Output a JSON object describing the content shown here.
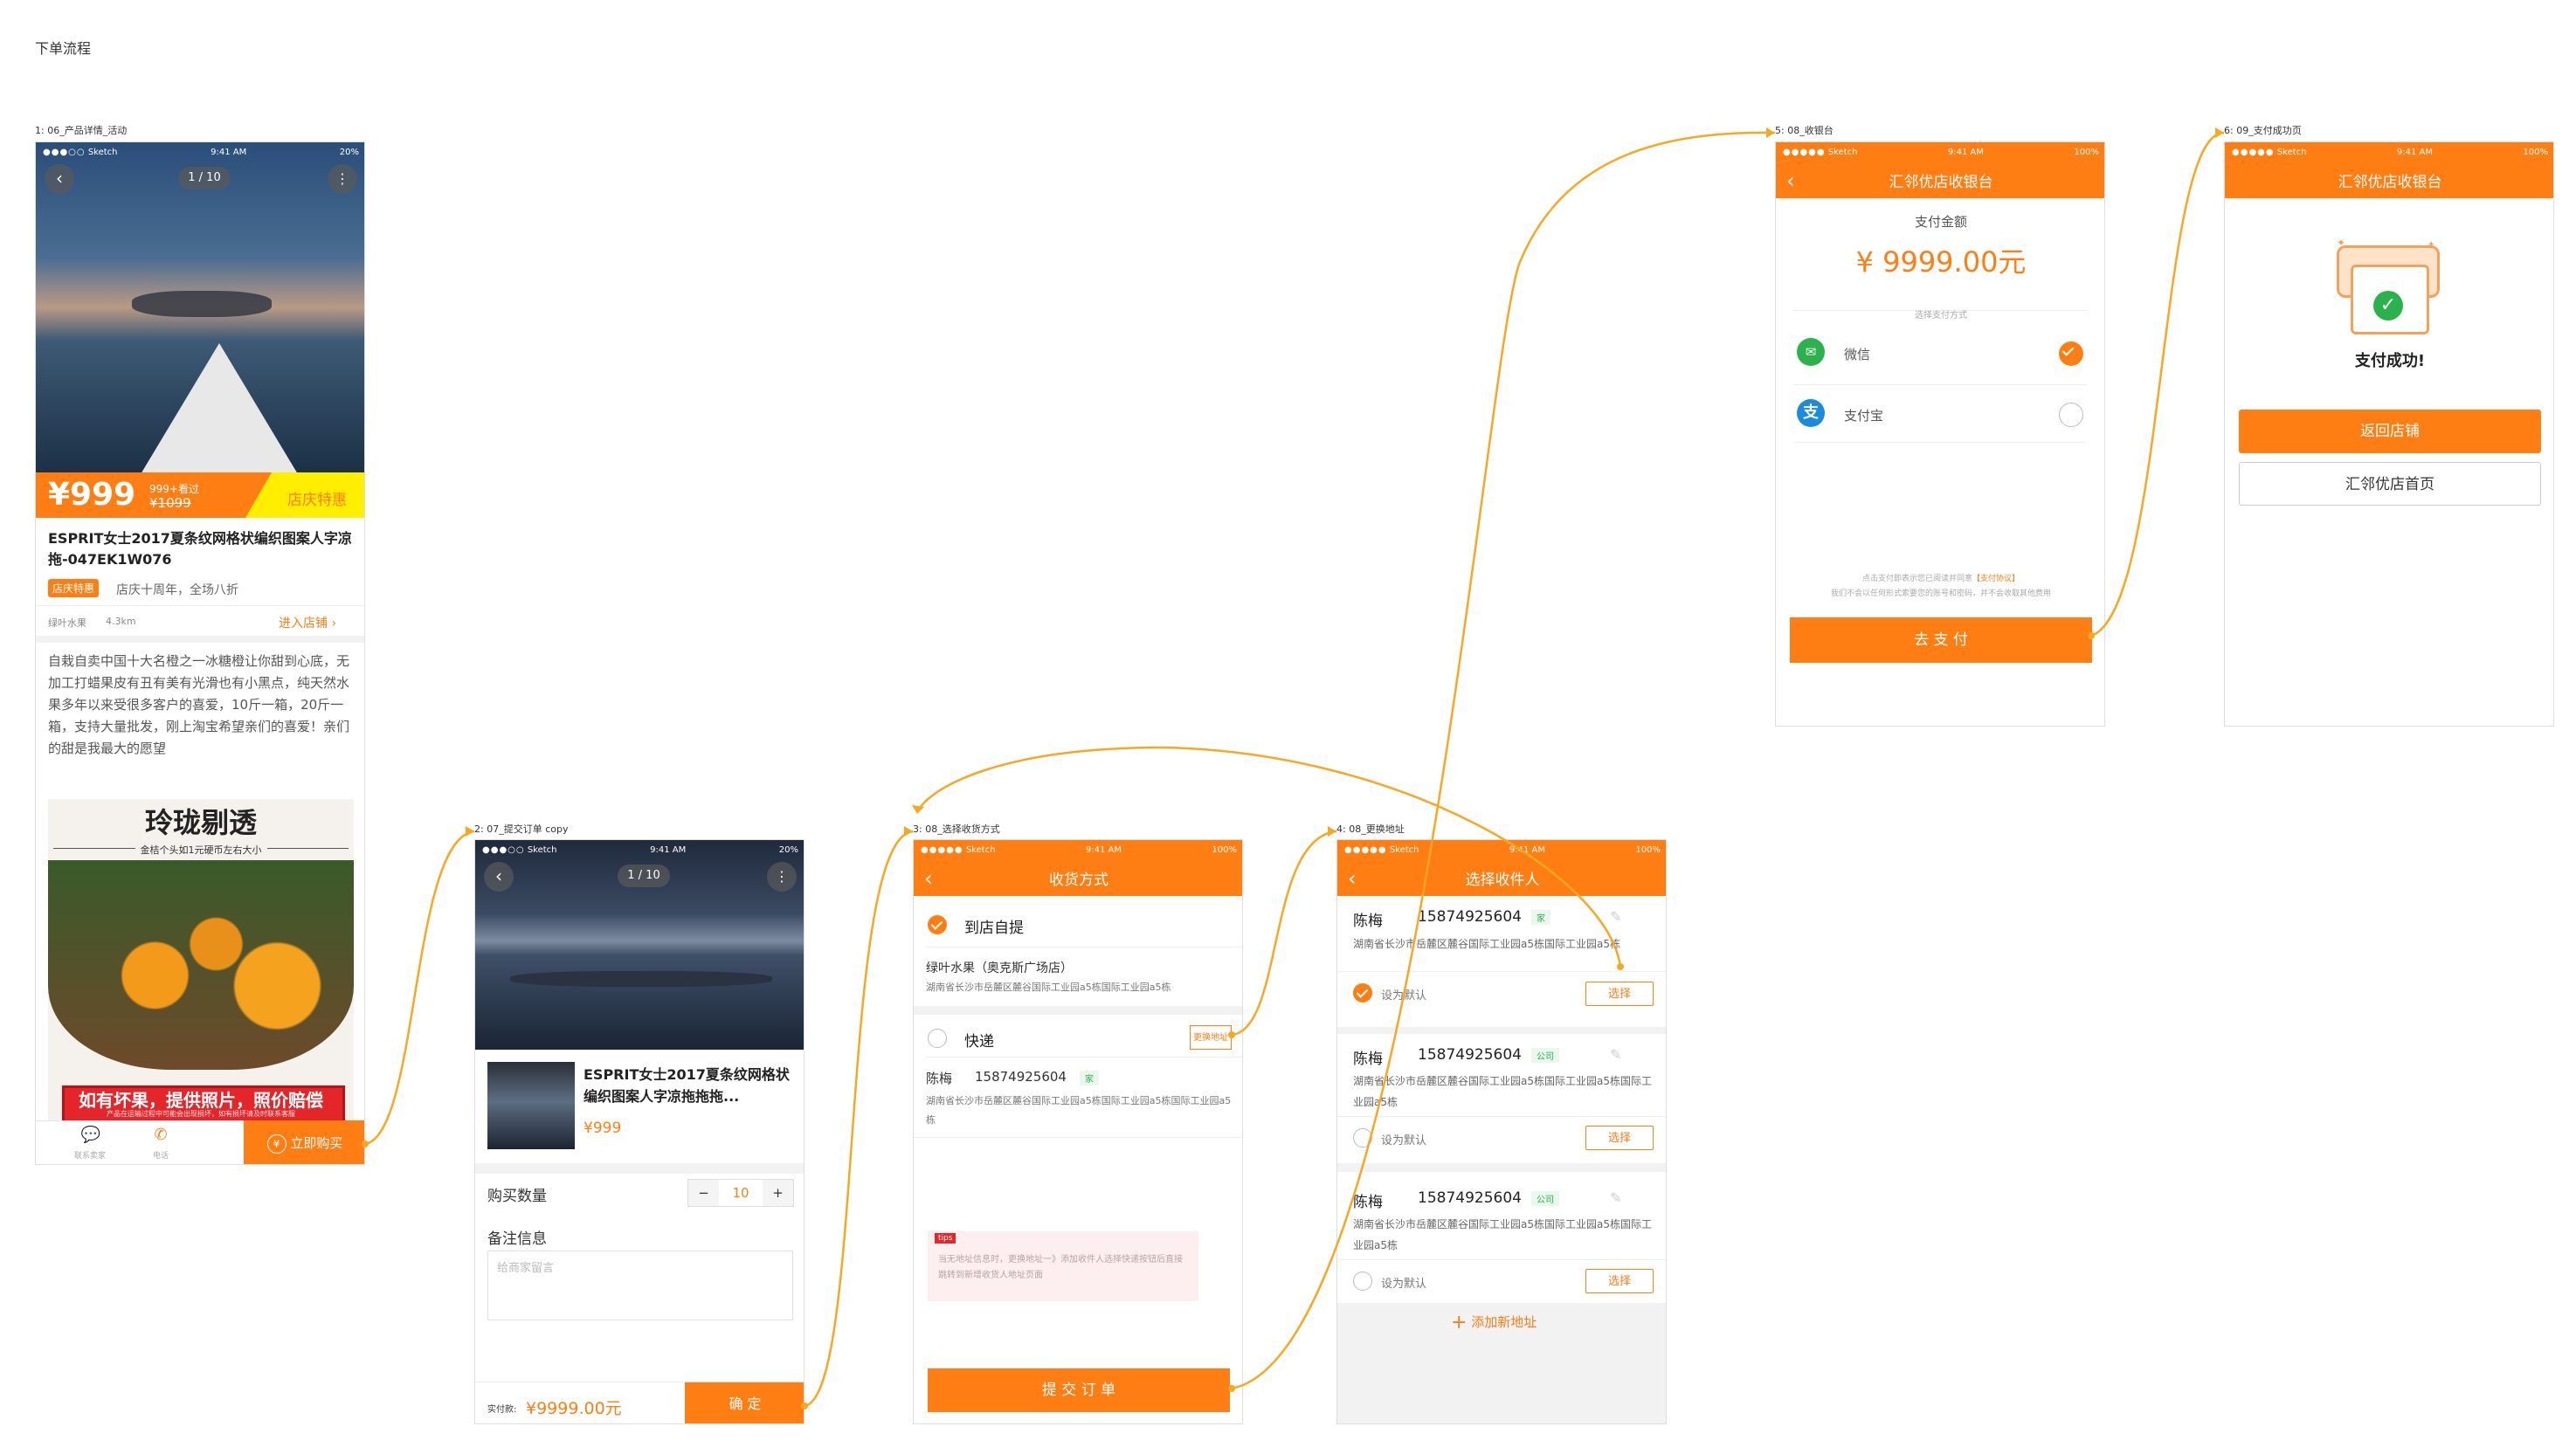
{
  "page_title": "下单流程",
  "colors": {
    "accent": "#ff7e14",
    "badge": "#ff7e14",
    "promo_yellow": "#ffee00",
    "success": "#2bb24c"
  },
  "connectors": 5,
  "status": {
    "carrier": "Sketch",
    "time": "9:41 AM",
    "battery_low": "20%",
    "battery_full": "100%"
  },
  "s1": {
    "label": "1: 06_产品详情_活动",
    "counter": "1 / 10",
    "price": "¥999",
    "sold": "999+看过",
    "old_price": "¥1099",
    "promo_tag": "店庆特惠",
    "title": "ESPRIT女士2017夏条纹网格状编织图案人字凉拖-047EK1W076",
    "badge": "店庆特惠",
    "promo_text": "店庆十周年，全场八折",
    "store": "绿叶水果",
    "distance": "4.3km",
    "enter_store": "进入店铺",
    "description": "自栽自卖中国十大名橙之一冰糖橙让你甜到心底，无加工打蜡果皮有丑有美有光滑也有小黑点，纯天然水果多年以来受很多客户的喜爱，10斤一箱，20斤一箱，支持大量批发，刚上淘宝希望亲们的喜爱！亲们的甜是我最大的愿望",
    "banner_title": "玲珑剔透",
    "banner_sub": "金桔个头如1元硬币左右大小",
    "guarantee": "如有坏果，提供照片，照价赔偿",
    "guarantee_small": "产品在运输过程中可能会出现损坏，如有损坏请及时联系客服",
    "tab1": "联系卖家",
    "tab2": "电话",
    "buy_now": "立即购买"
  },
  "s2": {
    "label": "2: 07_提交订单 copy",
    "counter": "1 / 10",
    "title": "ESPRIT女士2017夏条纹网格状编织图案人字凉拖拖拖...",
    "price": "¥999",
    "qty_label": "购买数量",
    "qty": "10",
    "minus": "−",
    "plus": "+",
    "remark_label": "备注信息",
    "remark_placeholder": "给商家留言",
    "pay_label": "实付款:",
    "pay_amount": "¥9999.00元",
    "confirm": "确 定"
  },
  "s3": {
    "label": "3: 08_选择收货方式",
    "nav_title": "收货方式",
    "opt1": "到店自提",
    "store_name": "绿叶水果（奥克斯广场店）",
    "store_addr": "湖南省长沙市岳麓区麓谷国际工业园a5栋国际工业园a5栋",
    "opt2": "快递",
    "change_addr": "更换地址",
    "name": "陈梅",
    "phone": "15874925604",
    "tag": "家",
    "addr": "湖南省长沙市岳麓区麓谷国际工业园a5栋国际工业园a5栋国际工业园a5栋",
    "tips_tag": "tips",
    "tips_text": "当无地址信息时，更换地址一》添加收件人选择快递按钮后直接跳转到新增收货人地址页面",
    "submit": "提 交 订 单"
  },
  "s4": {
    "label": "4: 08_更换地址",
    "nav_title": "选择收件人",
    "entries": [
      {
        "name": "陈梅",
        "phone": "15874925604",
        "tag": "家",
        "addr": "湖南省长沙市岳麓区麓谷国际工业园a5栋国际工业园a5栋",
        "default_label": "设为默认",
        "choose": "选择"
      },
      {
        "name": "陈梅",
        "phone": "15874925604",
        "tag": "公司",
        "addr": "湖南省长沙市岳麓区麓谷国际工业园a5栋国际工业园a5栋国际工业园a5栋",
        "default_label": "设为默认",
        "choose": "选择"
      },
      {
        "name": "陈梅",
        "phone": "15874925604",
        "tag": "公司",
        "addr": "湖南省长沙市岳麓区麓谷国际工业园a5栋国际工业园a5栋国际工业园a5栋",
        "default_label": "设为默认",
        "choose": "选择"
      }
    ],
    "add": "添加新地址"
  },
  "s5": {
    "label": "5: 08_收银台",
    "nav_title": "汇邻优店收银台",
    "amount_label": "支付金额",
    "amount": "¥ 9999.00元",
    "method_label": "选择支付方式",
    "wechat": "微信",
    "alipay": "支付宝",
    "agree_text": "点击支付即表示您已阅读并同意",
    "agree_link": "【支付协议】",
    "notice": "我们不会以任何形式索要您的账号和密码，并不会收取其他费用",
    "pay_btn": "去 支 付"
  },
  "s6": {
    "label": "6: 09_支付成功页",
    "nav_title": "汇邻优店收银台",
    "success": "支付成功!",
    "back_store": "返回店铺",
    "home": "汇邻优店首页"
  }
}
